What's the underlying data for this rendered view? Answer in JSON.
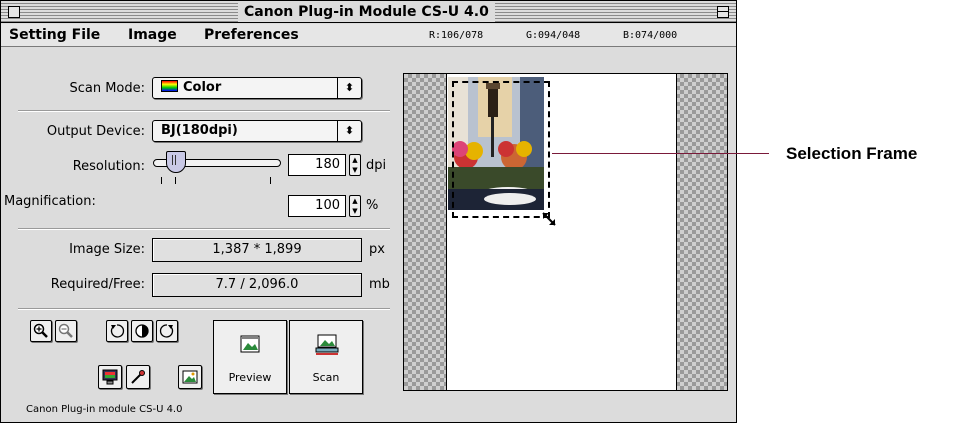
{
  "window": {
    "title": "Canon Plug-in Module CS-U 4.0"
  },
  "menu": {
    "items": [
      "Setting File",
      "Image",
      "Preferences"
    ]
  },
  "rgb_readout": {
    "r": "R:106/078",
    "g": "G:094/048",
    "b": "B:074/000"
  },
  "scan_mode": {
    "label": "Scan Mode:",
    "value": "Color"
  },
  "output_device": {
    "label": "Output Device:",
    "value": "BJ(180dpi)"
  },
  "resolution": {
    "label": "Resolution:",
    "value": "180",
    "unit": "dpi",
    "slider_level": 0.12
  },
  "magnification": {
    "label": "Magnification:",
    "value": "100",
    "unit": "%"
  },
  "image_size": {
    "label": "Image Size:",
    "value": "1,387 * 1,899",
    "unit": "px"
  },
  "required_free": {
    "label": "Required/Free:",
    "value": "7.7 / 2,096.0",
    "unit": "mb"
  },
  "buttons": {
    "preview": "Preview",
    "scan": "Scan"
  },
  "status": "Canon Plug-in module CS-U 4.0",
  "annotation": {
    "label": "Selection Frame"
  },
  "icons": [
    "zoom-in-icon",
    "zoom-out-icon",
    "rotate-left-icon",
    "flip-icon",
    "rotate-right-icon",
    "monitor-icon",
    "eyedropper-icon",
    "image-icon",
    "preview-icon",
    "scan-icon",
    "resize-handle-icon"
  ],
  "colors": {
    "callout_line": "#7a1a3a"
  }
}
